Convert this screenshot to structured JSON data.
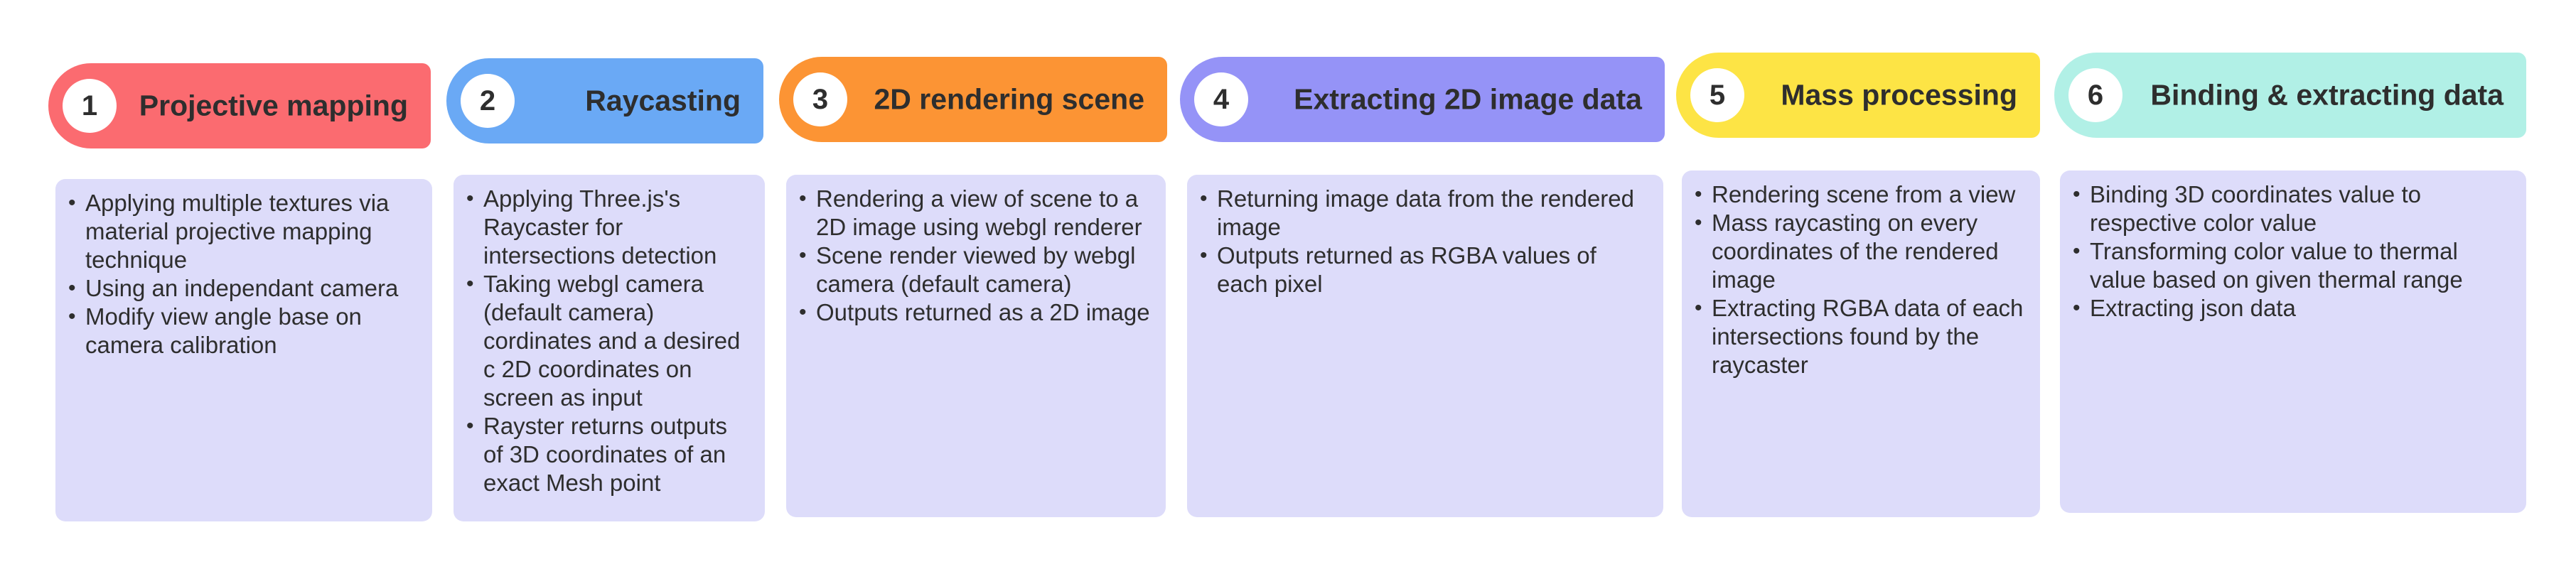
{
  "colors": {
    "step1": "#fb6b70",
    "step2": "#6aa9f5",
    "step3": "#fc9434",
    "step4": "#9593f7",
    "step5": "#fde445",
    "step6": "#b1f0e6",
    "panel": "#dddcfa"
  },
  "steps": [
    {
      "number": "1",
      "title": "Projective mapping",
      "bullets": [
        "Applying multiple textures via material projective mapping technique",
        "Using an independant camera",
        "Modify view angle base on camera calibration"
      ]
    },
    {
      "number": "2",
      "title": "Raycasting",
      "bullets": [
        "Applying Three.js's Raycaster for intersections detection",
        "Taking webgl camera (default camera) cordinates and a desired c 2D coordinates on screen as input",
        "Rayster returns outputs of 3D coordinates of an exact Mesh point"
      ]
    },
    {
      "number": "3",
      "title": "2D rendering scene",
      "bullets": [
        "Rendering a view of scene to a 2D image using webgl renderer",
        "Scene render viewed by webgl camera (default camera)",
        "Outputs returned as a 2D image"
      ]
    },
    {
      "number": "4",
      "title": "Extracting 2D image data",
      "bullets": [
        "Returning image data from the rendered image",
        "Outputs returned as RGBA values of each pixel"
      ]
    },
    {
      "number": "5",
      "title": "Mass processing",
      "bullets": [
        "Rendering scene from a view",
        "Mass raycasting on every coordinates of the rendered image",
        "Extracting RGBA data of each intersections found by the raycaster"
      ]
    },
    {
      "number": "6",
      "title": "Binding & extracting data",
      "bullets": [
        "Binding 3D coordinates value to respective color value",
        "Transforming color value to thermal value based on given thermal range",
        "Extracting json data"
      ]
    }
  ]
}
